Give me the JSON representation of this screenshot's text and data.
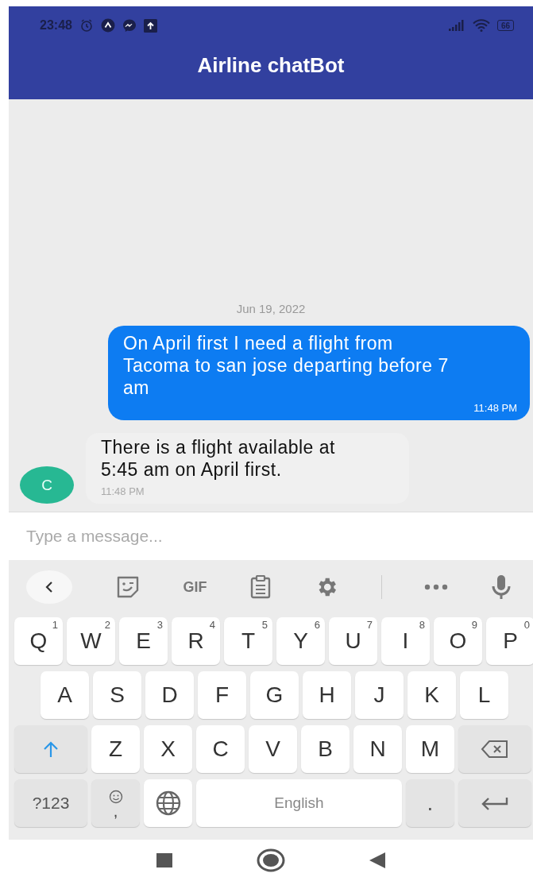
{
  "status_bar": {
    "time": "23:48",
    "battery": "66"
  },
  "header": {
    "title": "Airline chatBot"
  },
  "chat": {
    "date": "Jun 19, 2022",
    "messages": [
      {
        "kind": "outgoing",
        "text": "On April first I need a flight from Tacoma to san jose departing before 7 am",
        "time": "11:48 PM"
      },
      {
        "kind": "incoming",
        "avatar": "C",
        "text": "There is a flight available at 5:45 am on April first.",
        "time": "11:48 PM"
      }
    ]
  },
  "composer": {
    "placeholder": "Type a message..."
  },
  "keyboard": {
    "toolbar": [
      {
        "kind": "back"
      },
      {
        "kind": "sticker"
      },
      {
        "kind": "gif",
        "label": "GIF"
      },
      {
        "kind": "clipboard"
      },
      {
        "kind": "settings"
      },
      {
        "kind": "divider"
      },
      {
        "kind": "more"
      },
      {
        "kind": "mic"
      }
    ],
    "rows": [
      {
        "keys": [
          {
            "kind": "letter",
            "label": "Q",
            "hint": "1"
          },
          {
            "kind": "letter",
            "label": "W",
            "hint": "2"
          },
          {
            "kind": "letter",
            "label": "E",
            "hint": "3"
          },
          {
            "kind": "letter",
            "label": "R",
            "hint": "4"
          },
          {
            "kind": "letter",
            "label": "T",
            "hint": "5"
          },
          {
            "kind": "letter",
            "label": "Y",
            "hint": "6"
          },
          {
            "kind": "letter",
            "label": "U",
            "hint": "7"
          },
          {
            "kind": "letter",
            "label": "I",
            "hint": "8"
          },
          {
            "kind": "letter",
            "label": "O",
            "hint": "9"
          },
          {
            "kind": "letter",
            "label": "P",
            "hint": "0"
          }
        ]
      },
      {
        "keys": [
          {
            "kind": "letter",
            "label": "A"
          },
          {
            "kind": "letter",
            "label": "S"
          },
          {
            "kind": "letter",
            "label": "D"
          },
          {
            "kind": "letter",
            "label": "F"
          },
          {
            "kind": "letter",
            "label": "G"
          },
          {
            "kind": "letter",
            "label": "H"
          },
          {
            "kind": "letter",
            "label": "J"
          },
          {
            "kind": "letter",
            "label": "K"
          },
          {
            "kind": "letter",
            "label": "L"
          }
        ]
      },
      {
        "keys": [
          {
            "kind": "shift"
          },
          {
            "kind": "letter",
            "label": "Z"
          },
          {
            "kind": "letter",
            "label": "X"
          },
          {
            "kind": "letter",
            "label": "C"
          },
          {
            "kind": "letter",
            "label": "V"
          },
          {
            "kind": "letter",
            "label": "B"
          },
          {
            "kind": "letter",
            "label": "N"
          },
          {
            "kind": "letter",
            "label": "M"
          },
          {
            "kind": "backspace"
          }
        ]
      },
      {
        "keys": [
          {
            "kind": "symbols",
            "label": "?123"
          },
          {
            "kind": "emoji",
            "label": ","
          },
          {
            "kind": "globe"
          },
          {
            "kind": "space",
            "label": "English"
          },
          {
            "kind": "period",
            "label": "."
          },
          {
            "kind": "enter"
          }
        ]
      }
    ]
  },
  "nav_bar": [
    {
      "kind": "recents"
    },
    {
      "kind": "home"
    },
    {
      "kind": "back"
    }
  ]
}
